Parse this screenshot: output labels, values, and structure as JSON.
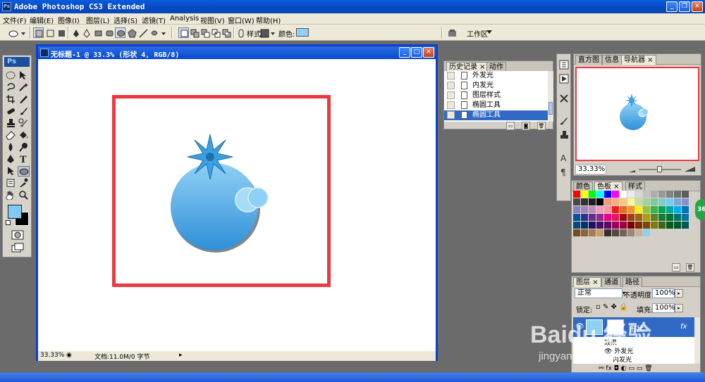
{
  "window": {
    "title": "Adobe Photoshop CS3 Extended",
    "app_badge": "Ps"
  },
  "menu": [
    "文件(F)",
    "编辑(E)",
    "图像(I)",
    "图层(L)",
    "选择(S)",
    "滤镜(T)",
    "Analysis",
    "视图(V)",
    "窗口(W)",
    "帮助(H)"
  ],
  "options": {
    "style_label": "样式:",
    "color_label": "颜色:",
    "color_swatch": "#8fd0f5",
    "workspace_label": "工作区"
  },
  "toolbox": {
    "logo": "Ps",
    "foreground_color": "#7fcbf4",
    "background_color": "#000000"
  },
  "document": {
    "title": "无标题-1 @ 33.3% (形状 4, RGB/8)",
    "zoom": "33.33%",
    "doc_info": "文档:11.0M/0 字节",
    "highlight_color": "#ea3a3f",
    "shape_top_color": "#8fd0f5",
    "shape_bottom_color": "#2f8fd8"
  },
  "history_panel": {
    "tabs": [
      "历史记录",
      "动作"
    ],
    "items": [
      {
        "label": "外发光",
        "selected": false
      },
      {
        "label": "内发光",
        "selected": false
      },
      {
        "label": "图层样式",
        "selected": false
      },
      {
        "label": "椭圆工具",
        "selected": false
      },
      {
        "label": "椭圆工具",
        "selected": true
      }
    ]
  },
  "navigator_panel": {
    "tabs": [
      "直方图",
      "信息",
      "导航器"
    ],
    "zoom": "33.33%"
  },
  "color_panel": {
    "tabs": [
      "颜色",
      "色板",
      "样式"
    ]
  },
  "layers_panel": {
    "tabs": [
      "图层",
      "通道",
      "路径"
    ],
    "blend_mode": "正常",
    "opacity_label": "不透明度:",
    "opacity": "100%",
    "lock_label": "锁定:",
    "fill_label": "填充:",
    "fill": "100%",
    "layer_name": "形状",
    "effects_label": "效果",
    "effects": [
      "外发光",
      "内发光"
    ]
  },
  "watermark": {
    "brand": "Baidu 经验",
    "url": "jingyan.baidu.com"
  },
  "badge": "36"
}
